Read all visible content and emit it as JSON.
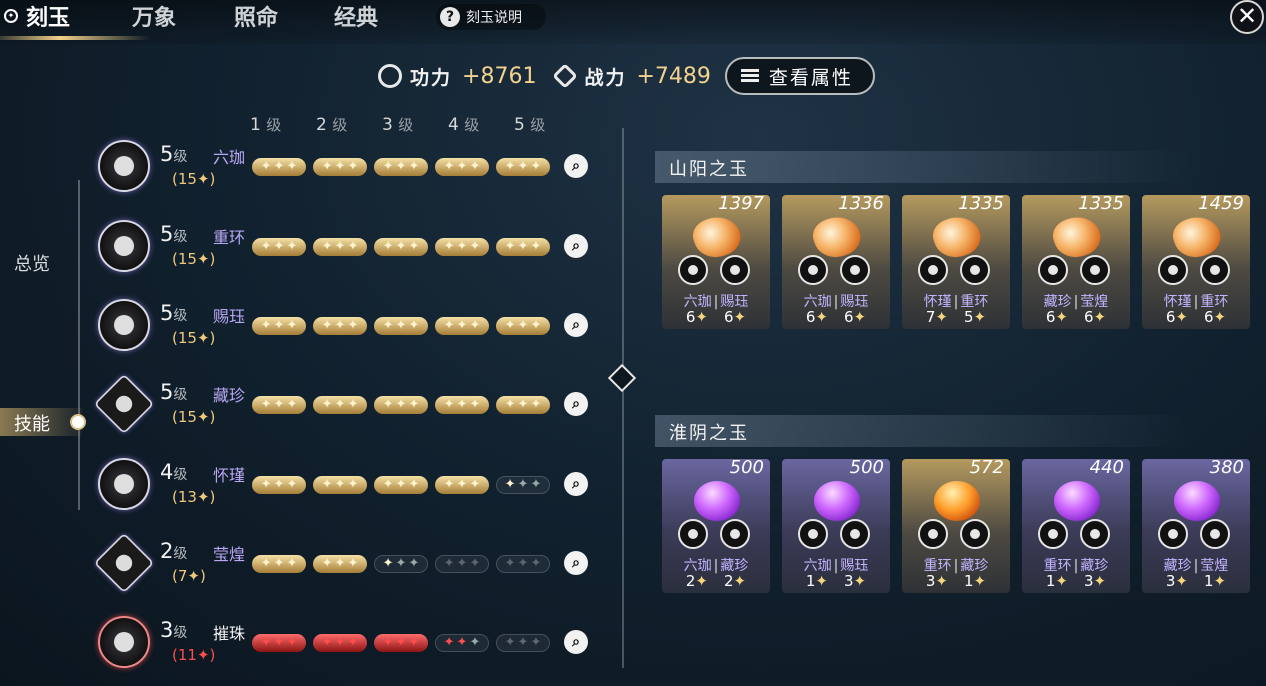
{
  "tabs": [
    {
      "label": "刻玉",
      "active": true
    },
    {
      "label": "万象"
    },
    {
      "label": "照命"
    },
    {
      "label": "经典"
    }
  ],
  "help": {
    "label": "刻玉说明",
    "icon": "question-icon"
  },
  "close": {
    "icon": "close-icon",
    "glyph": "✕"
  },
  "stats": {
    "gongli_label": "功力",
    "gongli_value": "+8761",
    "zhanli_label": "战力",
    "zhanli_value": "+7489",
    "attr_button": "查看属性"
  },
  "sidebar": {
    "overview": "总览",
    "skills": "技能"
  },
  "levels": [
    "1",
    "2",
    "3",
    "4",
    "5"
  ],
  "level_suffix": "级",
  "skills": [
    {
      "level": "5",
      "name": "六珈",
      "points": "(15✦)",
      "filled": [
        3,
        3,
        3,
        3,
        3
      ],
      "color": "gold"
    },
    {
      "level": "5",
      "name": "重环",
      "points": "(15✦)",
      "filled": [
        3,
        3,
        3,
        3,
        3
      ],
      "color": "gold"
    },
    {
      "level": "5",
      "name": "赐珏",
      "points": "(15✦)",
      "filled": [
        3,
        3,
        3,
        3,
        3
      ],
      "color": "gold"
    },
    {
      "level": "5",
      "name": "藏珍",
      "points": "(15✦)",
      "filled": [
        3,
        3,
        3,
        3,
        3
      ],
      "color": "gold"
    },
    {
      "level": "4",
      "name": "怀瑾",
      "points": "(13✦)",
      "filled": [
        3,
        3,
        3,
        3,
        1
      ],
      "color": "gold"
    },
    {
      "level": "2",
      "name": "莹煌",
      "points": "(7✦)",
      "filled": [
        3,
        3,
        1,
        0,
        0
      ],
      "color": "gold"
    },
    {
      "level": "3",
      "name": "摧珠",
      "points": "(11✦)",
      "filled": [
        3,
        3,
        3,
        2,
        0
      ],
      "color": "red"
    }
  ],
  "sections": [
    {
      "title": "山阳之玉",
      "cards": [
        {
          "score": "1397",
          "gem": "orange",
          "a": "六珈",
          "b": "赐珏",
          "na": "6",
          "nb": "6"
        },
        {
          "score": "1336",
          "gem": "orange",
          "a": "六珈",
          "b": "赐珏",
          "na": "6",
          "nb": "6"
        },
        {
          "score": "1335",
          "gem": "orange",
          "a": "怀瑾",
          "b": "重环",
          "na": "7",
          "nb": "5"
        },
        {
          "score": "1335",
          "gem": "orange",
          "a": "藏珍",
          "b": "莹煌",
          "na": "6",
          "nb": "6"
        },
        {
          "score": "1459",
          "gem": "orange",
          "a": "怀瑾",
          "b": "重环",
          "na": "6",
          "nb": "6"
        }
      ]
    },
    {
      "title": "淮阴之玉",
      "cards": [
        {
          "score": "500",
          "gem": "violet",
          "a": "六珈",
          "b": "藏珍",
          "na": "2",
          "nb": "2"
        },
        {
          "score": "500",
          "gem": "violet",
          "a": "六珈",
          "b": "赐珏",
          "na": "1",
          "nb": "3"
        },
        {
          "score": "572",
          "gem": "amber",
          "a": "重环",
          "b": "藏珍",
          "na": "3",
          "nb": "1"
        },
        {
          "score": "440",
          "gem": "violet",
          "a": "重环",
          "b": "藏珍",
          "na": "1",
          "nb": "3"
        },
        {
          "score": "380",
          "gem": "violet",
          "a": "藏珍",
          "b": "莹煌",
          "na": "3",
          "nb": "1"
        }
      ]
    }
  ]
}
